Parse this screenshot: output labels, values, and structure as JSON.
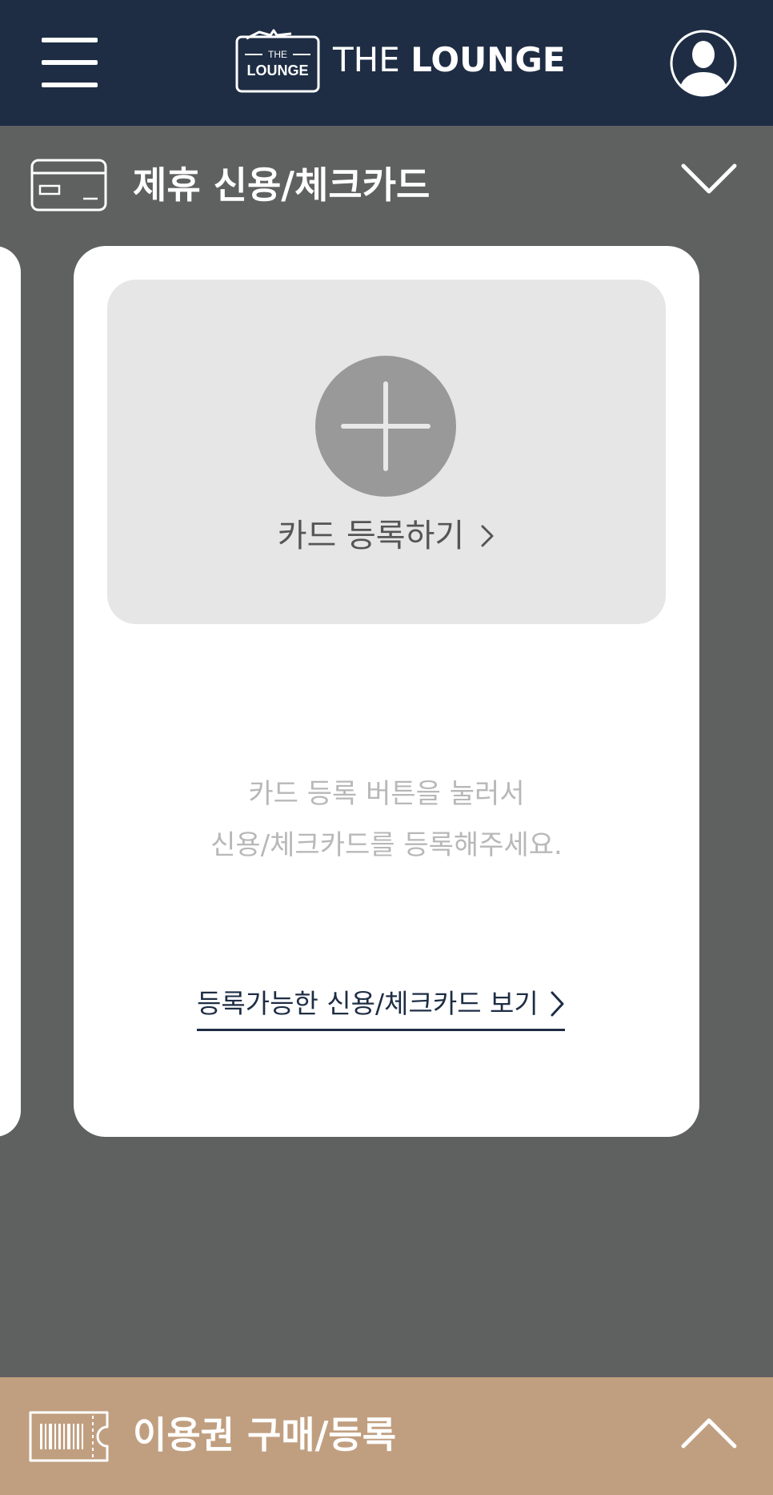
{
  "header": {
    "menu_icon": "hamburger-menu-icon",
    "logo": {
      "badge_top": "THE",
      "badge_bottom": "LOUNGE",
      "text_light": "THE ",
      "text_bold": "LOUNGE"
    },
    "profile_icon": "user-profile-icon"
  },
  "card_section": {
    "icon": "credit-card-icon",
    "title": "제휴 신용/체크카드",
    "toggle_icon": "chevron-down-icon",
    "card": {
      "add_label": "카드 등록하기",
      "hint_line1": "카드 등록 버튼을 눌러서",
      "hint_line2": "신용/체크카드를 등록해주세요.",
      "available_link": "등록가능한 신용/체크카드 보기"
    }
  },
  "bottom_bar": {
    "icon": "ticket-barcode-icon",
    "title": "이용권 구매/등록",
    "toggle_icon": "chevron-up-icon"
  },
  "colors": {
    "header_bg": "#1e2d44",
    "page_bg": "#5f6060",
    "add_area_bg": "#e6e6e6",
    "plus_circle": "#999999",
    "bottom_bar_bg": "#c09f80"
  }
}
